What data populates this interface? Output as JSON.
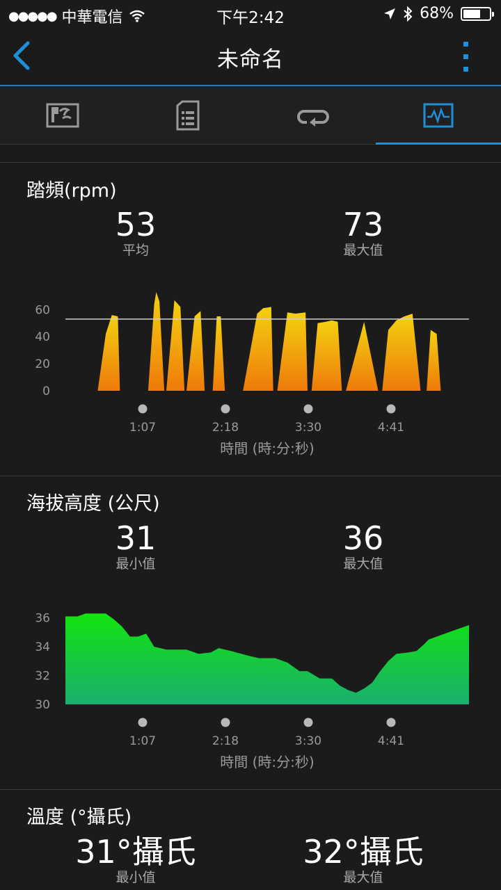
{
  "status_bar": {
    "carrier": "中華電信",
    "time": "下午2:42",
    "battery": "68%",
    "battery_level": 0.68
  },
  "nav": {
    "title": "未命名",
    "back_icon": "chevron-left-icon",
    "menu_icon": "vertical-dots-icon"
  },
  "tabs": [
    {
      "icon": "map-icon"
    },
    {
      "icon": "document-list-icon"
    },
    {
      "icon": "laps-loop-icon"
    },
    {
      "icon": "chart-icon",
      "active": true
    }
  ],
  "accent_color": "#1f8fd8",
  "cadence": {
    "title": "踏頻(rpm)",
    "stat1": {
      "value": "53",
      "label": "平均"
    },
    "stat2": {
      "value": "73",
      "label": "最大值"
    },
    "chart_data": {
      "type": "area",
      "ylim": [
        0,
        73
      ],
      "yticks": [
        "60",
        "40",
        "20",
        "0"
      ],
      "ytick_values": [
        60,
        40,
        20,
        0
      ],
      "avg_line": 53,
      "xticks": [
        "1:07",
        "2:18",
        "3:30",
        "4:41"
      ],
      "xlabel": "時間 (時:分:秒)",
      "segments": [
        [
          [
            0.08,
            0
          ],
          [
            0.1,
            42
          ],
          [
            0.115,
            56
          ],
          [
            0.13,
            55
          ],
          [
            0.135,
            0
          ]
        ],
        [
          [
            0.205,
            0
          ],
          [
            0.22,
            64
          ],
          [
            0.225,
            73
          ],
          [
            0.233,
            66
          ],
          [
            0.245,
            0
          ]
        ],
        [
          [
            0.25,
            0
          ],
          [
            0.27,
            67
          ],
          [
            0.285,
            62
          ],
          [
            0.295,
            0
          ]
        ],
        [
          [
            0.3,
            0
          ],
          [
            0.32,
            55
          ],
          [
            0.335,
            59
          ],
          [
            0.345,
            0
          ]
        ],
        [
          [
            0.365,
            0
          ],
          [
            0.375,
            55
          ],
          [
            0.385,
            55
          ],
          [
            0.395,
            0
          ]
        ],
        [
          [
            0.44,
            0
          ],
          [
            0.475,
            57
          ],
          [
            0.49,
            61
          ],
          [
            0.51,
            62
          ],
          [
            0.515,
            0
          ]
        ],
        [
          [
            0.525,
            0
          ],
          [
            0.55,
            58
          ],
          [
            0.57,
            57
          ],
          [
            0.595,
            58
          ],
          [
            0.6,
            0
          ]
        ],
        [
          [
            0.61,
            0
          ],
          [
            0.625,
            50
          ],
          [
            0.645,
            51
          ],
          [
            0.66,
            52
          ],
          [
            0.675,
            51
          ],
          [
            0.685,
            0
          ]
        ],
        [
          [
            0.695,
            0
          ],
          [
            0.74,
            51
          ],
          [
            0.775,
            0
          ]
        ],
        [
          [
            0.785,
            0
          ],
          [
            0.8,
            45
          ],
          [
            0.82,
            52
          ],
          [
            0.84,
            55
          ],
          [
            0.86,
            57
          ],
          [
            0.88,
            0
          ]
        ],
        [
          [
            0.895,
            0
          ],
          [
            0.905,
            45
          ],
          [
            0.92,
            42
          ],
          [
            0.93,
            0
          ]
        ]
      ],
      "gradient": [
        "#f3d110",
        "#ee7a0a"
      ]
    }
  },
  "altitude": {
    "title": "海拔高度 (公尺)",
    "stat1": {
      "value": "31",
      "label": "最小值"
    },
    "stat2": {
      "value": "36",
      "label": "最大值"
    },
    "chart_data": {
      "type": "area",
      "ylim": [
        30,
        36.8
      ],
      "yticks": [
        "36",
        "34",
        "32",
        "30"
      ],
      "ytick_values": [
        36,
        34,
        32,
        30
      ],
      "xticks": [
        "1:07",
        "2:18",
        "3:30",
        "4:41"
      ],
      "xlabel": "時間 (時:分:秒)",
      "points": [
        [
          0,
          36.1
        ],
        [
          0.03,
          36.1
        ],
        [
          0.05,
          36.3
        ],
        [
          0.08,
          36.3
        ],
        [
          0.1,
          36.3
        ],
        [
          0.12,
          35.9
        ],
        [
          0.14,
          35.4
        ],
        [
          0.16,
          34.7
        ],
        [
          0.18,
          34.7
        ],
        [
          0.2,
          34.9
        ],
        [
          0.22,
          34
        ],
        [
          0.25,
          33.8
        ],
        [
          0.3,
          33.8
        ],
        [
          0.33,
          33.5
        ],
        [
          0.36,
          33.6
        ],
        [
          0.38,
          33.9
        ],
        [
          0.41,
          33.7
        ],
        [
          0.45,
          33.4
        ],
        [
          0.48,
          33.2
        ],
        [
          0.52,
          33.2
        ],
        [
          0.55,
          32.9
        ],
        [
          0.58,
          32.3
        ],
        [
          0.6,
          32.3
        ],
        [
          0.63,
          31.8
        ],
        [
          0.66,
          31.8
        ],
        [
          0.68,
          31.3
        ],
        [
          0.7,
          31
        ],
        [
          0.72,
          30.8
        ],
        [
          0.74,
          31.1
        ],
        [
          0.76,
          31.5
        ],
        [
          0.78,
          32.3
        ],
        [
          0.8,
          33
        ],
        [
          0.82,
          33.5
        ],
        [
          0.85,
          33.6
        ],
        [
          0.87,
          33.7
        ],
        [
          0.89,
          34.2
        ],
        [
          0.9,
          34.5
        ],
        [
          0.93,
          34.8
        ],
        [
          0.95,
          35
        ],
        [
          1,
          35.5
        ]
      ],
      "gradient": [
        "#12e40f",
        "#1aaf6e"
      ]
    }
  },
  "temperature": {
    "title": "溫度 (°攝氏)",
    "stat1": {
      "value": "31°攝氏",
      "label": "最小值"
    },
    "stat2": {
      "value": "32°攝氏",
      "label": "最大值"
    }
  }
}
